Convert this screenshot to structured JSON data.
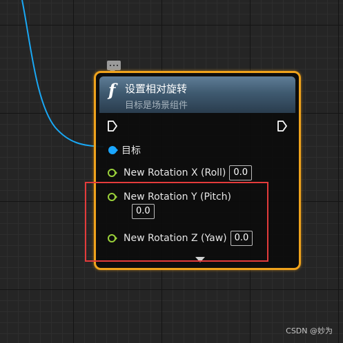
{
  "node": {
    "title": "设置相对旋转",
    "subtitle": "目标是场景组件",
    "function_icon": "f",
    "target_label": "目标",
    "pins": [
      {
        "label": "New Rotation X (Roll)",
        "value": "0.0"
      },
      {
        "label": "New Rotation Y (Pitch)",
        "value": "0.0"
      },
      {
        "label": "New Rotation Z (Yaw)",
        "value": "0.0"
      }
    ]
  },
  "colors": {
    "node_border_selected": "#f0a31c",
    "header": "#3f5a70",
    "object_pin": "#1aa6ff",
    "float_pin": "#9ad13a",
    "exec_pin": "#ffffff",
    "wire": "#19a8f5",
    "annotation_box": "#e43b3b"
  },
  "icons": {
    "comment": "comment-bubble-icon",
    "exec_in": "exec-pin-icon",
    "exec_out": "exec-pin-icon",
    "expand": "chevron-down-icon"
  },
  "watermark": "CSDN @妙为"
}
